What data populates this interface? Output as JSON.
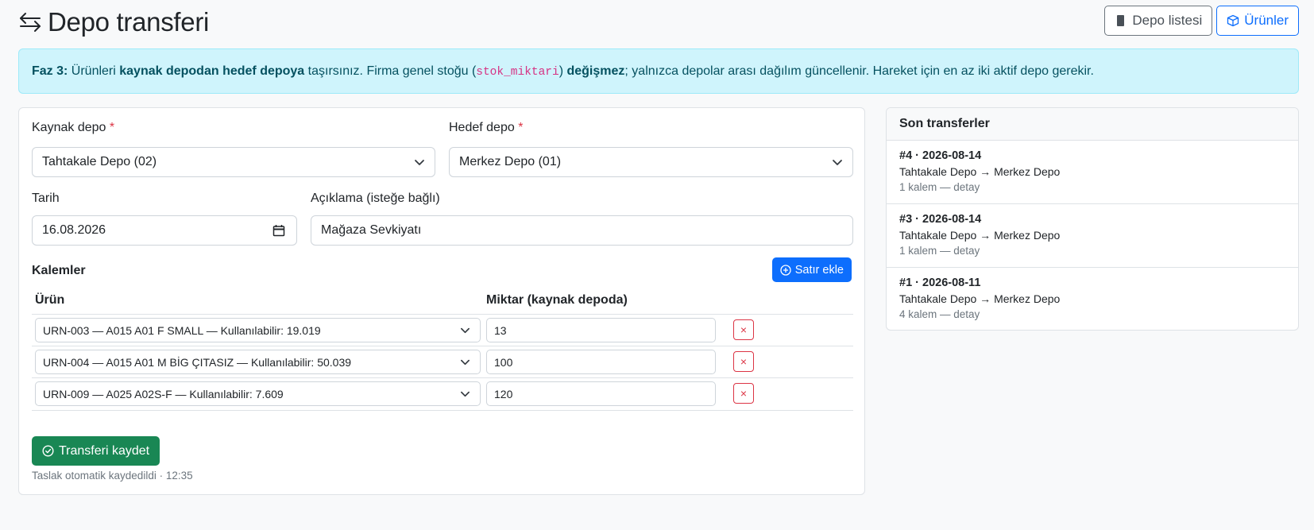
{
  "header": {
    "title": "Depo transferi",
    "depo_list_label": "Depo listesi",
    "products_label": "Ürünler"
  },
  "alert": {
    "phase": "Faz 3:",
    "t1": " Ürünleri ",
    "b1": "kaynak depodan hedef depoya",
    "t2": " taşırsınız. Firma genel stoğu (",
    "code": "stok_miktari",
    "t3": ") ",
    "b2": "değişmez",
    "t4": "; yalnızca depolar arası dağılım güncellenir. Hareket için en az iki aktif depo gerekir."
  },
  "form": {
    "source_label": "Kaynak depo",
    "source_value": "Tahtakale Depo (02)",
    "target_label": "Hedef depo",
    "target_value": "Merkez Depo (01)",
    "required_mark": "*",
    "date_label": "Tarih",
    "date_value": "16.08.2026",
    "desc_label": "Açıklama (isteğe bağlı)",
    "desc_value": "Mağaza Sevkiyatı"
  },
  "items": {
    "title": "Kalemler",
    "add_label": "Satır ekle",
    "col_product": "Ürün",
    "col_qty": "Miktar (kaynak depoda)",
    "delete_label": "×",
    "rows": [
      {
        "product": "URN-003 — A015 A01 F SMALL — Kullanılabilir: 19.019",
        "qty": "13"
      },
      {
        "product": "URN-004 — A015 A01 M BİG ÇITASIZ — Kullanılabilir: 50.039",
        "qty": "100"
      },
      {
        "product": "URN-009 — A025 A02S-F — Kullanılabilir: 7.609",
        "qty": "120"
      }
    ]
  },
  "save": {
    "label": "Transferi kaydet",
    "draft_note": "Taslak otomatik kaydedildi · 12:35"
  },
  "recent": {
    "title": "Son transferler",
    "items": [
      {
        "title": "#4 · 2026-08-14",
        "route": "Tahtakale Depo → Merkez Depo",
        "meta": "1 kalem — detay"
      },
      {
        "title": "#3 · 2026-08-14",
        "route": "Tahtakale Depo → Merkez Depo",
        "meta": "1 kalem — detay"
      },
      {
        "title": "#1 · 2026-08-11",
        "route": "Tahtakale Depo → Merkez Depo",
        "meta": "4 kalem — detay"
      }
    ]
  }
}
